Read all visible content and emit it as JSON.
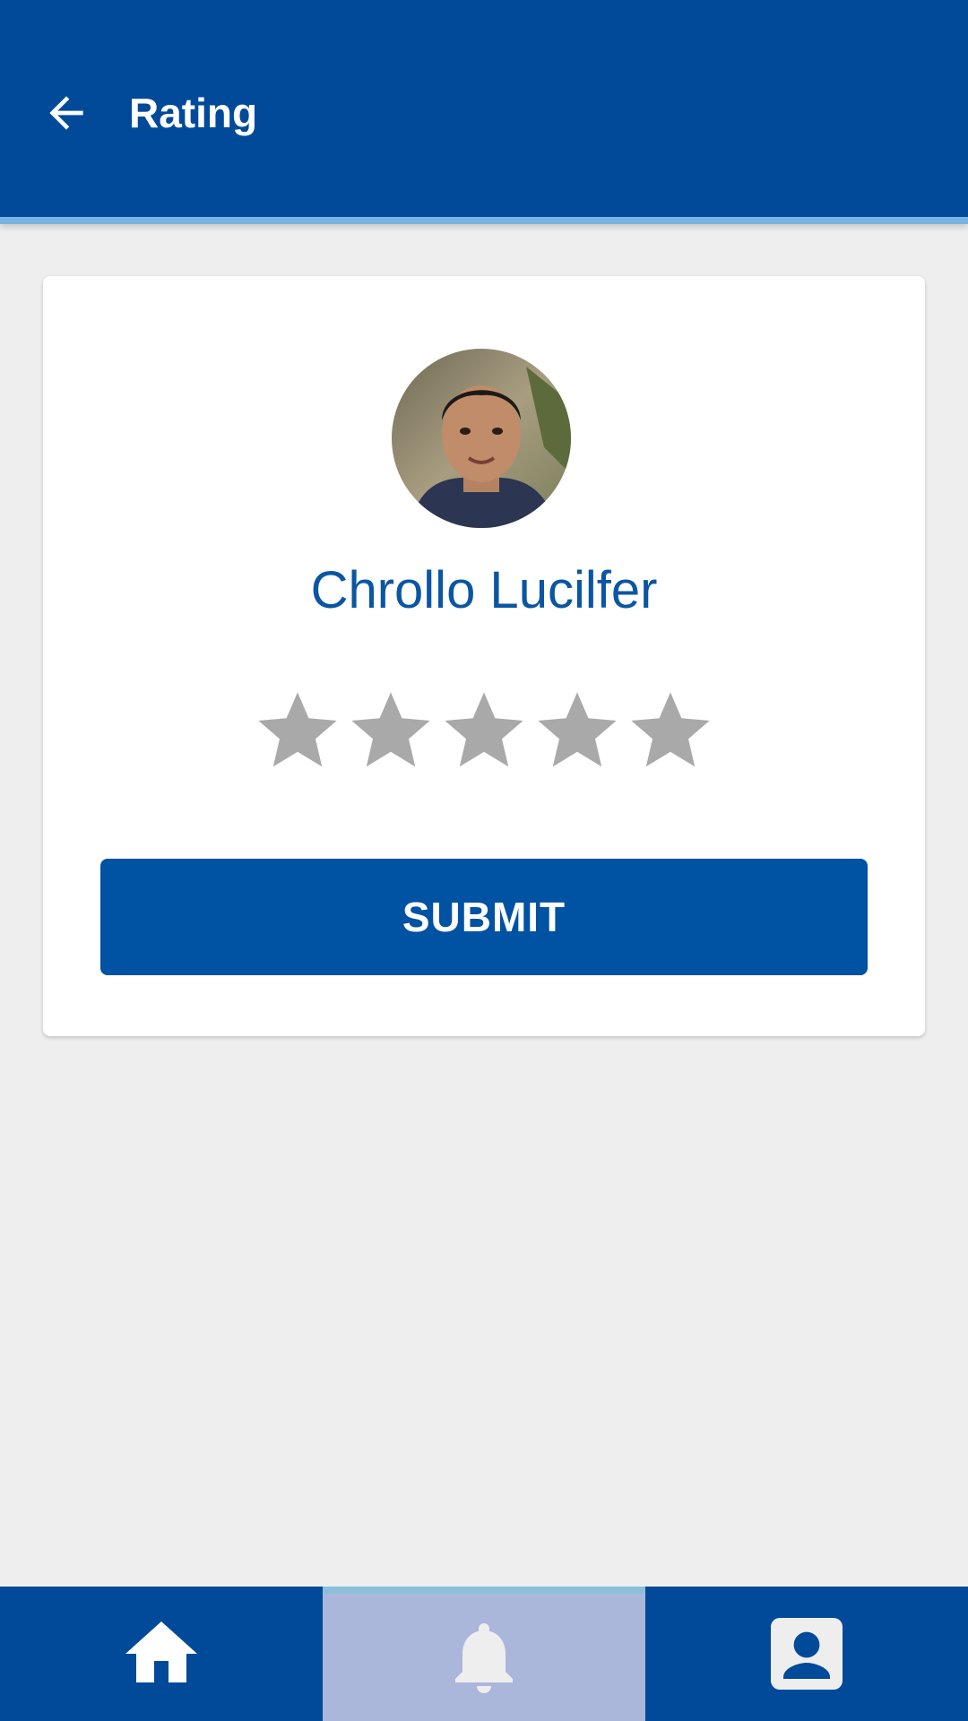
{
  "appbar": {
    "title": "Rating",
    "back_icon": "arrow-back-icon",
    "background": "#004a99"
  },
  "profile": {
    "name": "Chrollo Lucilfer",
    "avatar": "user-avatar-photo"
  },
  "rating": {
    "max": 5,
    "value": 0,
    "star_icon": "star-icon",
    "empty_color": "#a9a9a9"
  },
  "actions": {
    "submit_label": "SUBMIT"
  },
  "bottom_nav": {
    "items": [
      {
        "icon": "home-icon",
        "active": false
      },
      {
        "icon": "bell-icon",
        "active": true
      },
      {
        "icon": "contact-card-icon",
        "active": false
      }
    ],
    "background": "#004a99",
    "active_background": "#abb6db"
  }
}
